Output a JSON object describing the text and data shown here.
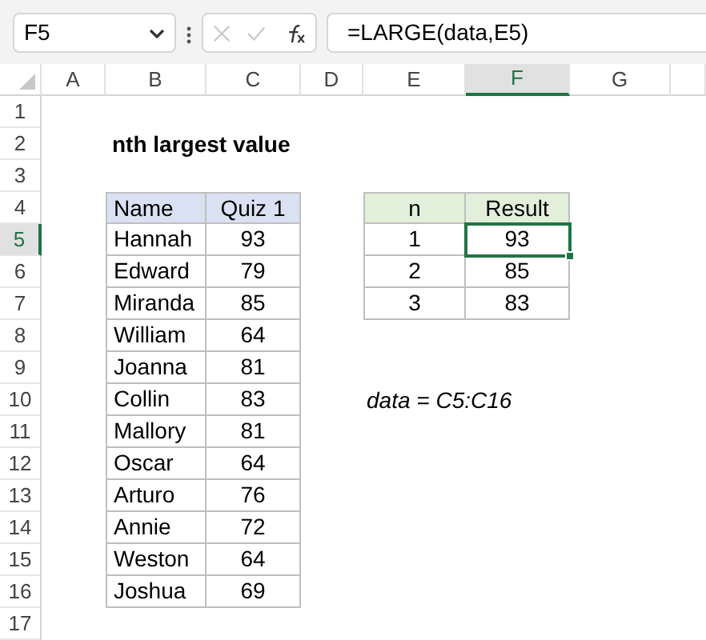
{
  "formula_bar": {
    "name_box": "F5",
    "formula": "=LARGE(data,E5)"
  },
  "columns": [
    {
      "label": "A",
      "selected": false
    },
    {
      "label": "B",
      "selected": false
    },
    {
      "label": "C",
      "selected": false
    },
    {
      "label": "D",
      "selected": false
    },
    {
      "label": "E",
      "selected": false
    },
    {
      "label": "F",
      "selected": true
    },
    {
      "label": "G",
      "selected": false
    }
  ],
  "rows": [
    {
      "label": "1",
      "selected": false
    },
    {
      "label": "2",
      "selected": false
    },
    {
      "label": "3",
      "selected": false
    },
    {
      "label": "4",
      "selected": false
    },
    {
      "label": "5",
      "selected": true
    },
    {
      "label": "6",
      "selected": false
    },
    {
      "label": "7",
      "selected": false
    },
    {
      "label": "8",
      "selected": false
    },
    {
      "label": "9",
      "selected": false
    },
    {
      "label": "10",
      "selected": false
    },
    {
      "label": "11",
      "selected": false
    },
    {
      "label": "12",
      "selected": false
    },
    {
      "label": "13",
      "selected": false
    },
    {
      "label": "14",
      "selected": false
    },
    {
      "label": "15",
      "selected": false
    },
    {
      "label": "16",
      "selected": false
    },
    {
      "label": "17",
      "selected": false
    }
  ],
  "title": "nth largest value",
  "data_table": {
    "columns": [
      "Name",
      "Quiz 1"
    ],
    "rows": [
      [
        "Hannah",
        "93"
      ],
      [
        "Edward",
        "79"
      ],
      [
        "Miranda",
        "85"
      ],
      [
        "William",
        "64"
      ],
      [
        "Joanna",
        "81"
      ],
      [
        "Collin",
        "83"
      ],
      [
        "Mallory",
        "81"
      ],
      [
        "Oscar",
        "64"
      ],
      [
        "Arturo",
        "76"
      ],
      [
        "Annie",
        "72"
      ],
      [
        "Weston",
        "64"
      ],
      [
        "Joshua",
        "69"
      ]
    ]
  },
  "result_table": {
    "columns": [
      "n",
      "Result"
    ],
    "rows": [
      {
        "n": "1",
        "result": "93",
        "selected": true
      },
      {
        "n": "2",
        "result": "85",
        "selected": false
      },
      {
        "n": "3",
        "result": "83",
        "selected": false
      }
    ]
  },
  "note": "data = C5:C16"
}
